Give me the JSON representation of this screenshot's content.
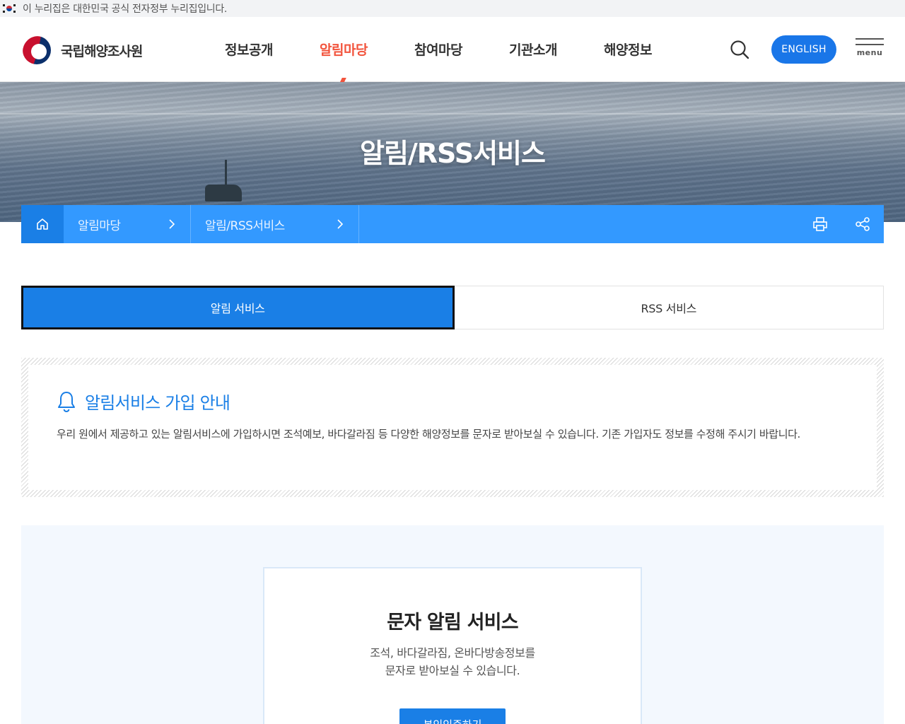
{
  "gov_banner": {
    "text": "이 누리집은 대한민국 공식 전자정부 누리집입니다."
  },
  "header": {
    "logo_text": "국립해양조사원",
    "nav": [
      {
        "label": "정보공개"
      },
      {
        "label": "알림마당",
        "active": true
      },
      {
        "label": "참여마당"
      },
      {
        "label": "기관소개"
      },
      {
        "label": "해양정보"
      }
    ],
    "english_label": "ENGLISH",
    "menu_label": "menu",
    "accent_color": "#f2543d"
  },
  "hero": {
    "title": "알림/RSS서비스"
  },
  "breadcrumb": {
    "items": [
      {
        "label": "알림마당"
      },
      {
        "label": "알림/RSS서비스"
      }
    ],
    "color": "#3399ff"
  },
  "tabs": [
    {
      "label": "알림 서비스",
      "active": true
    },
    {
      "label": "RSS 서비스",
      "active": false
    }
  ],
  "info": {
    "title": "알림서비스 가입 안내",
    "description": "우리 원에서 제공하고 있는 알림서비스에 가입하시면 조석예보, 바다갈라짐 등 다양한 해양정보를 문자로 받아보실 수 있습니다. 기존 가입자도 정보를 수정해 주시기 바랍니다."
  },
  "sms": {
    "title": "문자 알림 서비스",
    "desc_line1": "조석, 바다갈라짐, 온바다방송정보를",
    "desc_line2": "문자로 받아보실 수 있습니다.",
    "button_label": "본인인증하기"
  },
  "colors": {
    "primary": "#1a7fe6",
    "breadcrumb": "#3399ff"
  }
}
